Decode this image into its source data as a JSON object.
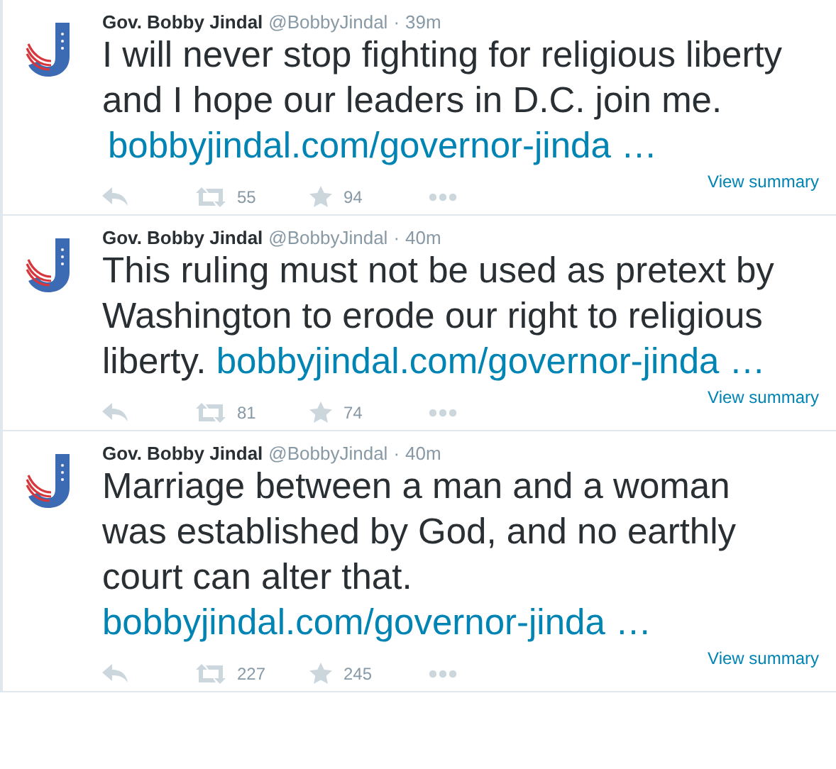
{
  "tweets": [
    {
      "name": "Gov. Bobby Jindal",
      "handle": "@BobbyJindal",
      "dot": "·",
      "time": "39m",
      "text": "I will never stop fighting for religious liberty and I hope our leaders in D.C. join me.",
      "link": "bobbyjindal.com/governor-jinda …",
      "link_break": true,
      "retweets": "55",
      "favorites": "94",
      "summary": "View summary"
    },
    {
      "name": "Gov. Bobby Jindal",
      "handle": "@BobbyJindal",
      "dot": "·",
      "time": "40m",
      "text": "This ruling must not be used as pretext by Washington to erode our right to religious liberty.",
      "link": "bobbyjindal.com/governor-jinda …",
      "link_break": false,
      "retweets": "81",
      "favorites": "74",
      "summary": "View summary"
    },
    {
      "name": "Gov. Bobby Jindal",
      "handle": "@BobbyJindal",
      "dot": "·",
      "time": "40m",
      "text": "Marriage between a man and a woman was established by God, and no earthly court can alter that.",
      "link": "bobbyjindal.com/governor-jinda …",
      "link_break": false,
      "retweets": "227",
      "favorites": "245",
      "summary": "View summary"
    }
  ]
}
